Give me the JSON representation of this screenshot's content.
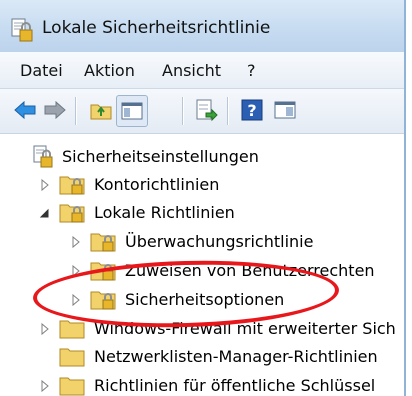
{
  "window": {
    "title": "Lokale Sicherheitsrichtlinie"
  },
  "menu": [
    "Datei",
    "Aktion",
    "Ansicht",
    "?"
  ],
  "toolbar": {
    "buttons": [
      "back-arrow-icon",
      "forward-arrow-icon",
      "up-folder-icon",
      "show-hide-console-tree-icon",
      "export-list-icon",
      "help-icon",
      "properties-view-icon"
    ]
  },
  "tree": {
    "root": "Sicherheitseinstellungen",
    "items": [
      {
        "label": "Kontorichtlinien",
        "level": 1,
        "expander": "collapsed"
      },
      {
        "label": "Lokale Richtlinien",
        "level": 1,
        "expander": "expanded"
      },
      {
        "label": "Überwachungsrichtlinie",
        "level": 2,
        "expander": "collapsed"
      },
      {
        "label": "Zuweisen von Benutzerrechten",
        "level": 2,
        "expander": "collapsed"
      },
      {
        "label": "Sicherheitsoptionen",
        "level": 2,
        "expander": "collapsed",
        "highlighted": true
      },
      {
        "label": "Windows-Firewall mit erweiterter Sich",
        "level": 1,
        "expander": "collapsed"
      },
      {
        "label": "Netzwerklisten-Manager-Richtlinien",
        "level": 1,
        "expander": "none"
      },
      {
        "label": "Richtlinien für öffentliche Schlüssel",
        "level": 1,
        "expander": "collapsed"
      }
    ]
  },
  "colors": {
    "highlight_oval": "#e8171b",
    "titlebar": "#c7dcf1",
    "folder": "#f2d36b"
  }
}
